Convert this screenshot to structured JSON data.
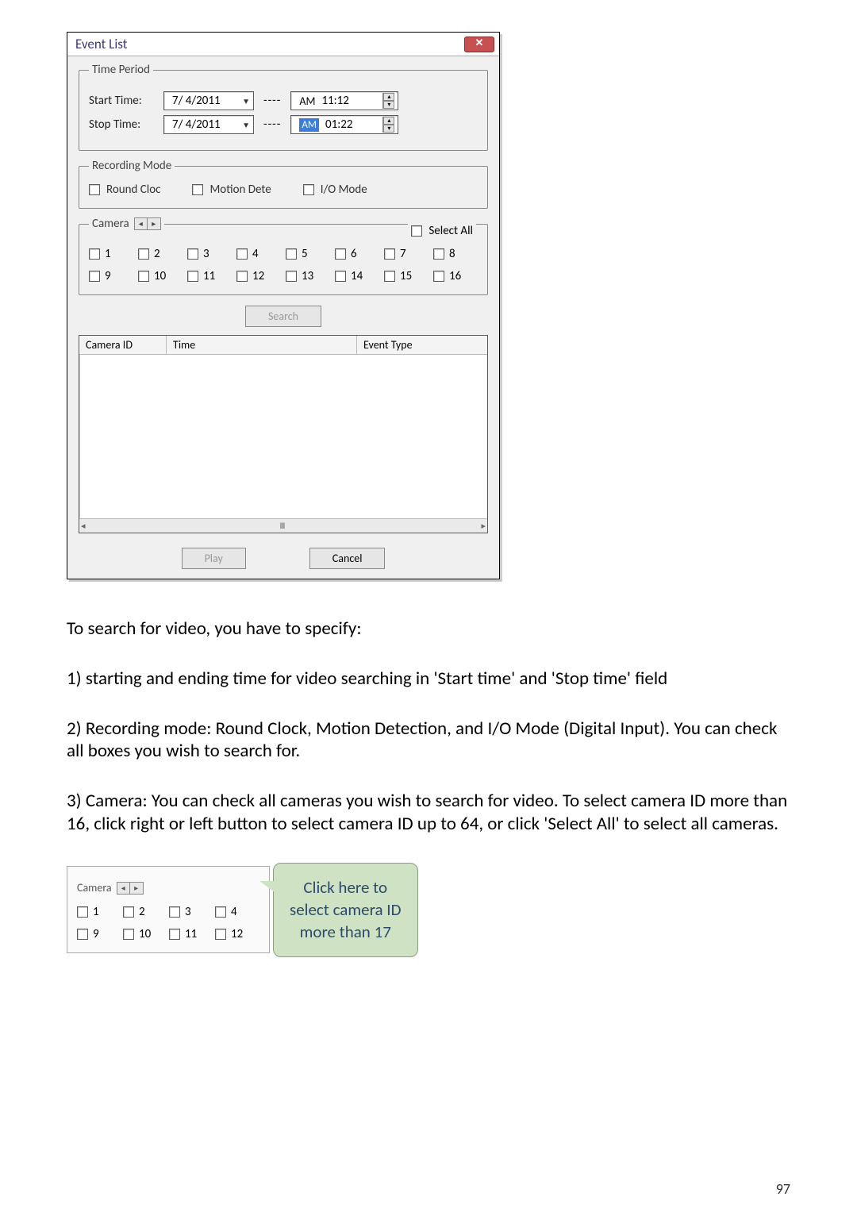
{
  "dialog": {
    "title": "Event List",
    "close": "✕",
    "timeperiod": {
      "legend": "Time Period",
      "start_label": "Start Time:",
      "stop_label": "Stop Time:",
      "start_date": "7/  4/2011",
      "stop_date": "7/  4/2011",
      "sep": "----",
      "start_ampm": "AM",
      "start_time": "11:12",
      "stop_ampm": "AM",
      "stop_time": "01:22"
    },
    "recmode": {
      "legend": "Recording Mode",
      "round": "Round Cloc",
      "motion": "Motion Dete",
      "io": "I/O Mode"
    },
    "camera": {
      "legend": "Camera",
      "select_all": "Select All",
      "row1": [
        "1",
        "2",
        "3",
        "4",
        "5",
        "6",
        "7",
        "8"
      ],
      "row2": [
        "9",
        "10",
        "11",
        "12",
        "13",
        "14",
        "15",
        "16"
      ]
    },
    "search_btn": "Search",
    "list": {
      "col1": "Camera ID",
      "col2": "Time",
      "col3": "Event Type",
      "scroll_left": "◂",
      "scroll_mid": "Ⅲ",
      "scroll_right": "▸"
    },
    "play_btn": "Play",
    "cancel_btn": "Cancel"
  },
  "body": {
    "p1": "To search for video, you have to specify:",
    "p2": "1) starting and ending time for video searching in 'Start time' and 'Stop time' field",
    "p3": "2) Recording mode: Round Clock, Motion Detection, and I/O Mode (Digital Input). You can check all boxes you wish to search for.",
    "p4": "3) Camera: You can check all cameras you wish to search for video. To select camera ID more than 16, click right or left button to select camera ID up to 64, or click 'Select All' to select all cameras."
  },
  "mini": {
    "legend": "Camera",
    "row1": [
      "1",
      "2",
      "3",
      "4"
    ],
    "row2": [
      "9",
      "10",
      "11",
      "12"
    ]
  },
  "callout": {
    "line1": "Click here to",
    "line2": "select camera ID",
    "line3": "more than 17"
  },
  "page_number": "97"
}
